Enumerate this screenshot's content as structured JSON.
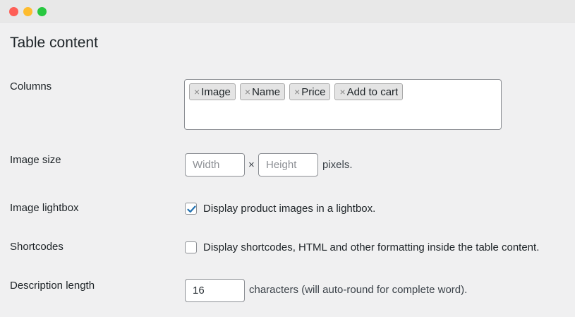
{
  "section": {
    "title": "Table content"
  },
  "columns": {
    "label": "Columns",
    "tags": [
      "Image",
      "Name",
      "Price",
      "Add to cart"
    ],
    "remove_glyph": "×"
  },
  "image_size": {
    "label": "Image size",
    "width_placeholder": "Width",
    "height_placeholder": "Height",
    "separator": "×",
    "unit": "pixels."
  },
  "image_lightbox": {
    "label": "Image lightbox",
    "checked": true,
    "text": "Display product images in a lightbox."
  },
  "shortcodes": {
    "label": "Shortcodes",
    "checked": false,
    "text": "Display shortcodes, HTML and other formatting inside the table content."
  },
  "description_length": {
    "label": "Description length",
    "value": "16",
    "suffix": "characters (will auto-round for complete word)."
  },
  "colors": {
    "accent": "#2271b1",
    "background": "#f0f0f1"
  }
}
